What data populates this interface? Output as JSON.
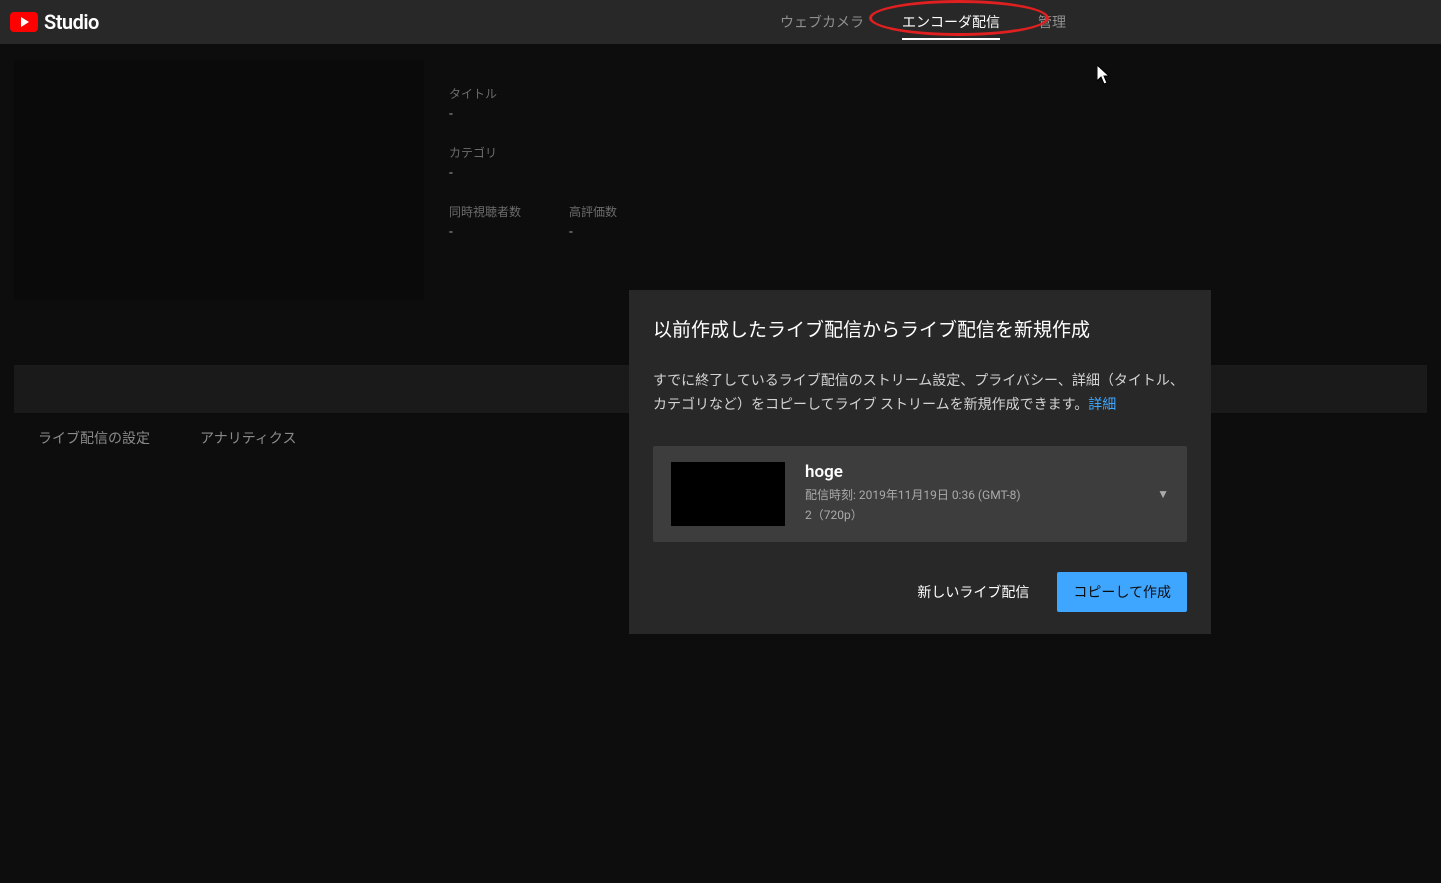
{
  "header": {
    "logo_text": "Studio"
  },
  "nav": {
    "tabs": [
      "ウェブカメラ",
      "エンコーダ配信",
      "管理"
    ],
    "active_index": 1
  },
  "info": {
    "title_label": "タイトル",
    "title_value": "-",
    "category_label": "カテゴリ",
    "category_value": "-",
    "viewers_label": "同時視聴者数",
    "viewers_value": "-",
    "likes_label": "高評価数",
    "likes_value": "-"
  },
  "sub_tabs": [
    "ライブ配信の設定",
    "アナリティクス"
  ],
  "modal": {
    "title": "以前作成したライブ配信からライブ配信を新規作成",
    "description": "すでに終了しているライブ配信のストリーム設定、プライバシー、詳細（タイトル、カテゴリなど）をコピーしてライブ ストリームを新規作成できます。",
    "detail_link": "詳細",
    "stream": {
      "title": "hoge",
      "broadcast_time": "配信時刻: 2019年11月19日 0:36 (GMT-8)",
      "quality": "2（720p）"
    },
    "actions": {
      "new_stream": "新しいライブ配信",
      "copy_create": "コピーして作成"
    }
  }
}
